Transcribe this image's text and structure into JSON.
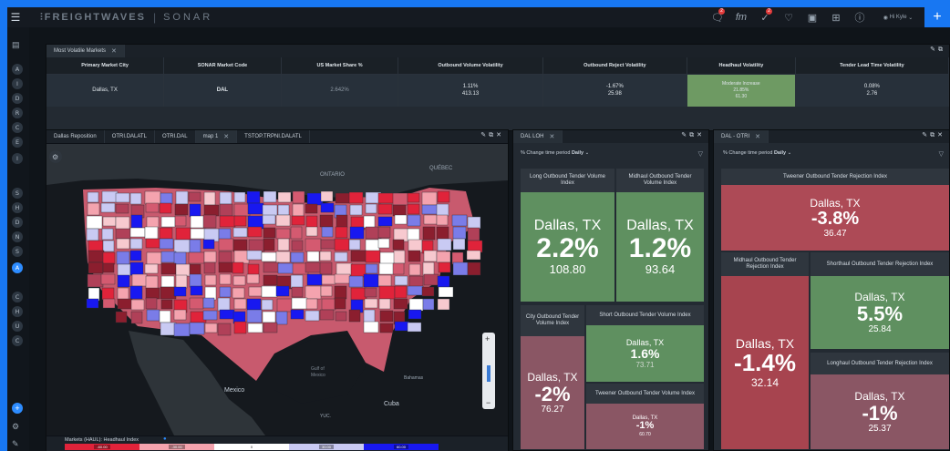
{
  "brand": {
    "logo": "FREIGHTWAVES",
    "product": "SONAR"
  },
  "topbar": {
    "user": "Hi Kyle",
    "badge1": "2",
    "badge2": "2"
  },
  "sidebar": {
    "letters": [
      "A",
      "I",
      "D",
      "R",
      "C",
      "E",
      "I",
      "S",
      "H",
      "D",
      "N",
      "S",
      "A",
      "C",
      "H",
      "U",
      "C"
    ]
  },
  "mv": {
    "tab": "Most Volatile Markets",
    "headers": [
      "Primary Market City",
      "SONAR Market Code",
      "US Market Share %",
      "Outbound Volume Volatility",
      "Outbound Reject Volatility",
      "Headhaul Volatility",
      "Tender Lead Time Volatility"
    ],
    "row": {
      "city": "Dallas, TX",
      "code": "DAL",
      "share": "2.642%",
      "vol_a": "1.11%",
      "vol_b": "413.13",
      "rej_a": "-1.67%",
      "rej_b": "25.98",
      "head_a": "Moderate Increase",
      "head_b": "21.85%",
      "head_c": "61.30",
      "lead_a": "0.08%",
      "lead_b": "2.76"
    }
  },
  "map": {
    "tabs": [
      "Dallas Reposition",
      "OTRI.DALATL",
      "OTRI.DAL",
      "map 1",
      "TSTOP.TRPNI.DALATL"
    ],
    "labels": {
      "ontario": "ONTARIO",
      "quebec": "QUÉBEC",
      "gulf": "Gulf of\nMexico",
      "mexico": "Mexico",
      "cuba": "Cuba",
      "bahamas": "Bahamas",
      "yucatan": "YUC."
    },
    "legend_title": "Markets (HAUL): Headhaul Index",
    "legend": [
      "-60.00",
      "-30.00",
      "0",
      "30.00",
      "60.00"
    ]
  },
  "loh": {
    "tab": "DAL LOH",
    "filter_label": "% Change time period",
    "filter_value": "Daily",
    "tiles": [
      {
        "h": "Long Outbound Tender Volume Index",
        "city": "Dallas, TX",
        "pct": "2.2%",
        "val": "108.80"
      },
      {
        "h": "Midhaul Outbound Tender Volume Index",
        "city": "Dallas, TX",
        "pct": "1.2%",
        "val": "93.64"
      },
      {
        "h": "City Outbound Tender Volume Index",
        "city": "Dallas, TX",
        "pct": "-2%",
        "val": "76.27"
      },
      {
        "h": "Short Outbound Tender Volume Index",
        "city": "Dallas, TX",
        "pct": "1.6%",
        "val": "73.71"
      },
      {
        "h": "Tweener Outbound Tender Volume Index",
        "city": "Dallas, TX",
        "pct": "-1%",
        "val": "60.70"
      }
    ]
  },
  "otri": {
    "tab": "DAL - OTRI",
    "filter_label": "% Change time period",
    "filter_value": "Daily",
    "tiles": [
      {
        "h": "Tweener Outbound Tender Rejection Index",
        "city": "Dallas, TX",
        "pct": "-3.8%",
        "val": "36.47"
      },
      {
        "h": "Midhaul Outbound Tender Rejection Index",
        "city": "Dallas, TX",
        "pct": "-1.4%",
        "val": "32.14"
      },
      {
        "h": "Shorthaul Outbound Tender Rejection Index",
        "city": "Dallas, TX",
        "pct": "5.5%",
        "val": "25.84"
      },
      {
        "h": "Longhaul Outbound Tender Rejection Index",
        "city": "Dallas, TX",
        "pct": "-1%",
        "val": "25.37"
      }
    ]
  },
  "colors": {
    "green": "#5e8f5a",
    "red": "#a9424d",
    "muted_red": "#8a5b66",
    "accent": "#1877f2"
  }
}
